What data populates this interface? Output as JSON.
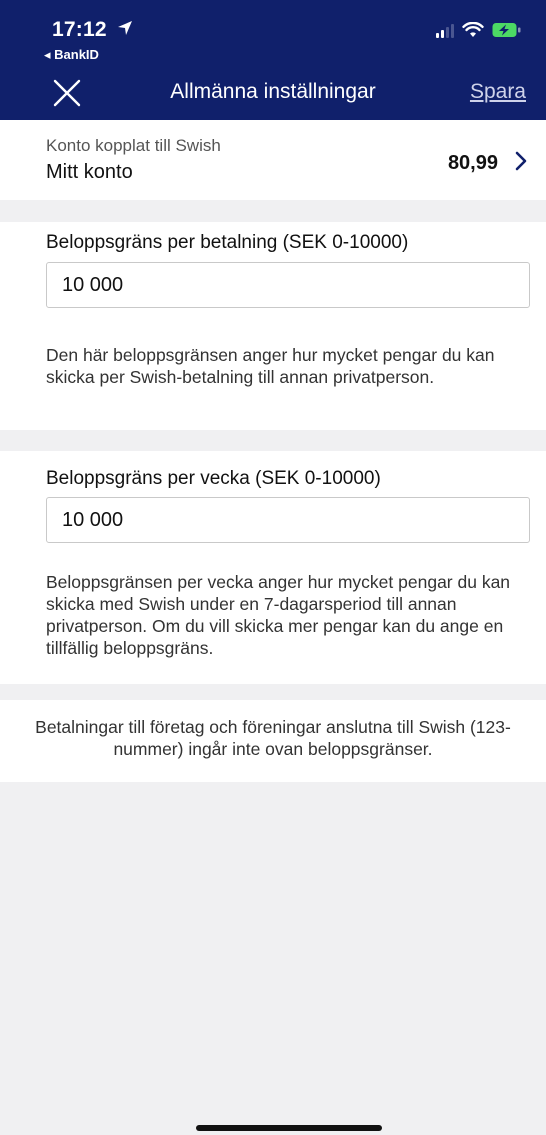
{
  "status_bar": {
    "time": "17:12",
    "back_app": "◂ BankID"
  },
  "nav": {
    "title": "Allmänna inställningar",
    "save_label": "Spara"
  },
  "account": {
    "label": "Konto kopplat till Swish",
    "name": "Mitt konto",
    "balance": "80,99"
  },
  "per_payment": {
    "label": "Beloppsgräns per betalning (SEK 0-10000)",
    "value": "10 000",
    "helper": "Den här beloppsgränsen anger hur mycket pengar du kan skicka per Swish-betalning till annan privatperson."
  },
  "per_week": {
    "label": "Beloppsgräns per vecka (SEK 0-10000)",
    "value": "10 000",
    "helper": "Beloppsgränsen per vecka anger hur mycket pengar du kan skicka med Swish under en 7-dagarsperiod till annan privatperson. Om du vill skicka mer pengar kan du ange en tillfällig beloppsgräns."
  },
  "footer_note": "Betalningar till företag och föreningar anslutna till Swish (123-nummer) ingår inte ovan beloppsgränser.",
  "colors": {
    "header": "#10206b",
    "accent": "#10206b",
    "background": "#f0f0f2",
    "battery_charging": "#4cd964"
  }
}
